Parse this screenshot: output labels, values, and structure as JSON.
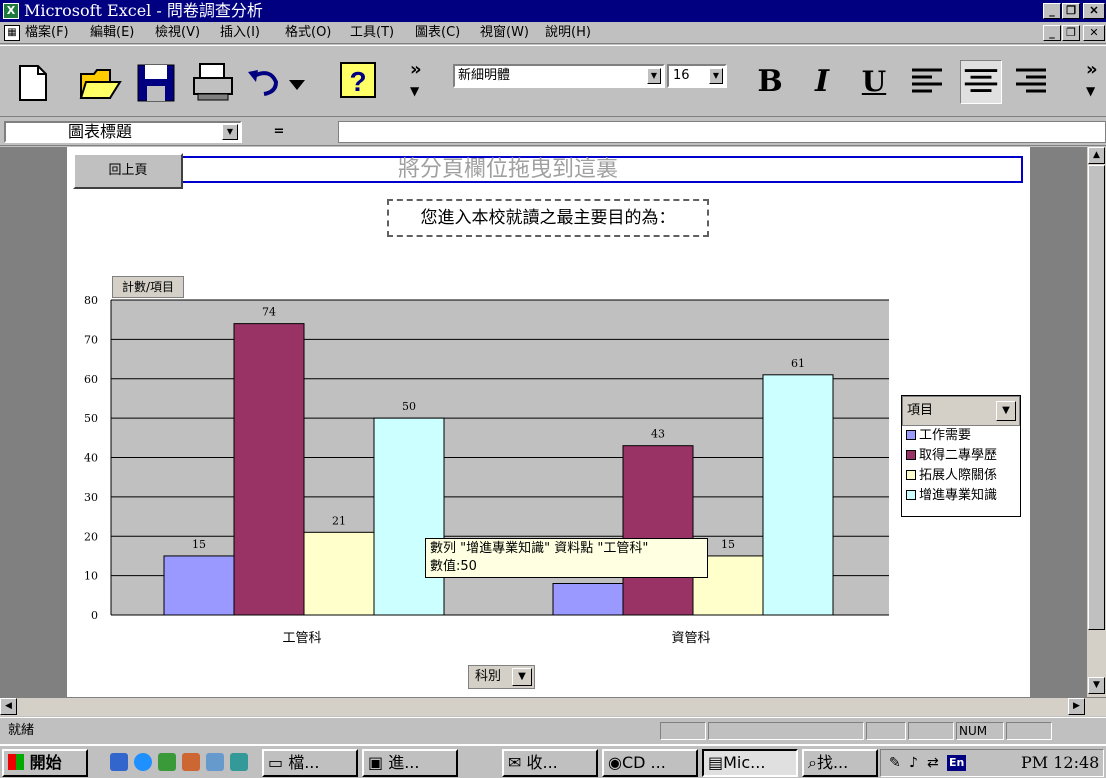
{
  "window": {
    "title": "Microsoft Excel - 問卷調查分析",
    "app_icon": "X"
  },
  "menu": {
    "items": [
      "檔案(F)",
      "編輯(E)",
      "檢視(V)",
      "插入(I)",
      "格式(O)",
      "工具(T)",
      "圖表(C)",
      "視窗(W)",
      "說明(H)"
    ]
  },
  "toolbar": {
    "font_name": "新細明體",
    "font_size": "16",
    "more": "»"
  },
  "formula_bar": {
    "name_box": "圖表標題",
    "equals": "="
  },
  "pivot": {
    "page_drop": "將分頁欄位拖曳到這裏",
    "back_button": "回上頁",
    "chart_title": "您進入本校就讀之最主要目的為：",
    "data_field": "計數/項目",
    "legend_field": "項目",
    "category_field": "科別"
  },
  "tooltip": {
    "line1": "數列 \"增進專業知識\" 資料點 \"工管科\"",
    "line2": "數值:50"
  },
  "status": {
    "left": "就緒",
    "num": "NUM"
  },
  "taskbar": {
    "start": "開始",
    "tasks": [
      "檔...",
      "進...",
      "收...",
      "CD ...",
      "Mic...",
      "找..."
    ],
    "tray_lang": "En",
    "clock": "PM 12:48"
  },
  "colors": {
    "series": [
      "#9999ff",
      "#993366",
      "#ffffcc",
      "#ccffff"
    ],
    "plot_bg": "#c0c0c0",
    "title_bar": "#000080"
  },
  "chart_data": {
    "type": "bar",
    "categories": [
      "工管科",
      "資管科"
    ],
    "series": [
      {
        "name": "工作需要",
        "values": [
          15,
          8
        ],
        "labels": [
          "15",
          ""
        ]
      },
      {
        "name": "取得二專學歷",
        "values": [
          74,
          43
        ],
        "labels": [
          "74",
          "43"
        ]
      },
      {
        "name": "拓展人際關係",
        "values": [
          21,
          15
        ],
        "labels": [
          "21",
          "15"
        ]
      },
      {
        "name": "增進專業知識",
        "values": [
          50,
          61
        ],
        "labels": [
          "50",
          "61"
        ]
      }
    ],
    "yticks": [
      "0",
      "10",
      "20",
      "30",
      "40",
      "50",
      "60",
      "70",
      "80"
    ],
    "ylim": [
      0,
      80
    ],
    "grid": true,
    "legend": "right"
  }
}
